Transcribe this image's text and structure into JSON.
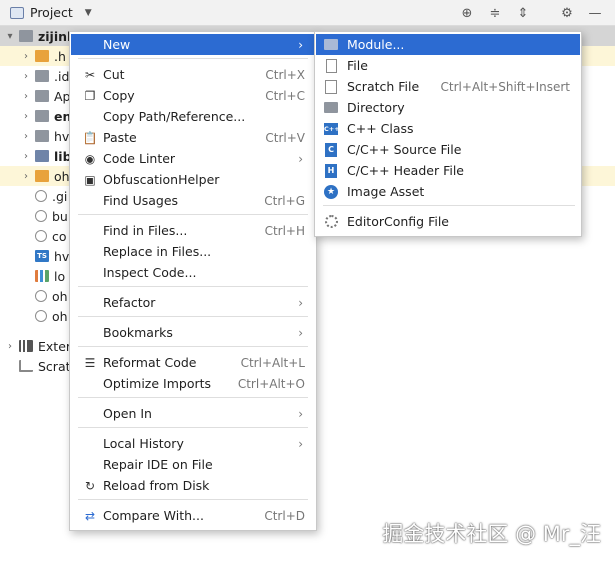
{
  "header": {
    "title": "Project",
    "tools": [
      "target-icon",
      "expand-all-icon",
      "collapse-all-icon",
      "gear-icon",
      "minimize-icon"
    ]
  },
  "tree": {
    "rows": [
      {
        "label": "zijinl",
        "bold": true,
        "arrow": "▾",
        "icon": "folder-gray"
      },
      {
        "label": ".h",
        "arrow": "›",
        "icon": "folder-orange"
      },
      {
        "label": ".id",
        "arrow": "›",
        "icon": "folder-gray"
      },
      {
        "label": "Ap",
        "arrow": "›",
        "icon": "folder-gray"
      },
      {
        "label": "en",
        "bold": true,
        "arrow": "›",
        "icon": "folder-gray"
      },
      {
        "label": "hv",
        "arrow": "›",
        "icon": "folder-gray"
      },
      {
        "label": "lib",
        "bold": true,
        "arrow": "›",
        "icon": "folder-blue"
      },
      {
        "label": "oh",
        "arrow": "›",
        "icon": "folder-orange"
      },
      {
        "label": ".gi",
        "arrow": "",
        "icon": "file-gear"
      },
      {
        "label": "bu",
        "arrow": "",
        "icon": "file-gear"
      },
      {
        "label": "co",
        "arrow": "",
        "icon": "file-gear"
      },
      {
        "label": "hv",
        "arrow": "",
        "icon": "file-ts"
      },
      {
        "label": "lo",
        "arrow": "",
        "icon": "file-bars"
      },
      {
        "label": "oh",
        "arrow": "",
        "icon": "file-gear"
      },
      {
        "label": "oh",
        "arrow": "",
        "icon": "file-gear"
      },
      {
        "label": "Exter",
        "arrow": "›",
        "icon": "file-lib"
      },
      {
        "label": "Scrat",
        "arrow": "",
        "icon": "file-scratch"
      }
    ]
  },
  "menu": {
    "new": {
      "label": "New",
      "submenu": "›"
    },
    "cut": {
      "label": "Cut",
      "shortcut": "Ctrl+X"
    },
    "copy": {
      "label": "Copy",
      "shortcut": "Ctrl+C"
    },
    "copy_path": {
      "label": "Copy Path/Reference..."
    },
    "paste": {
      "label": "Paste",
      "shortcut": "Ctrl+V"
    },
    "code_linter": {
      "label": "Code Linter",
      "submenu": "›"
    },
    "obfuscation": {
      "label": "ObfuscationHelper"
    },
    "find_usages": {
      "label": "Find Usages",
      "shortcut": "Ctrl+G"
    },
    "find_in_files": {
      "label": "Find in Files...",
      "shortcut": "Ctrl+H"
    },
    "replace_in_files": {
      "label": "Replace in Files..."
    },
    "inspect_code": {
      "label": "Inspect Code..."
    },
    "refactor": {
      "label": "Refactor",
      "submenu": "›"
    },
    "bookmarks": {
      "label": "Bookmarks",
      "submenu": "›"
    },
    "reformat": {
      "label": "Reformat Code",
      "shortcut": "Ctrl+Alt+L"
    },
    "optimize": {
      "label": "Optimize Imports",
      "shortcut": "Ctrl+Alt+O"
    },
    "open_in": {
      "label": "Open In",
      "submenu": "›"
    },
    "local_history": {
      "label": "Local History",
      "submenu": "›"
    },
    "repair_ide": {
      "label": "Repair IDE on File"
    },
    "reload": {
      "label": "Reload from Disk"
    },
    "compare": {
      "label": "Compare With...",
      "shortcut": "Ctrl+D"
    }
  },
  "submenu": {
    "module": {
      "label": "Module..."
    },
    "file": {
      "label": "File"
    },
    "scratch": {
      "label": "Scratch File",
      "shortcut": "Ctrl+Alt+Shift+Insert"
    },
    "directory": {
      "label": "Directory"
    },
    "cpp_class": {
      "label": "C++ Class",
      "icon_text": "C++"
    },
    "c_source": {
      "label": "C/C++ Source File",
      "icon_text": "C"
    },
    "c_header": {
      "label": "C/C++ Header File",
      "icon_text": "H"
    },
    "image_asset": {
      "label": "Image Asset"
    },
    "editorconfig": {
      "label": "EditorConfig File"
    }
  },
  "colors": {
    "selection": "#2c6bd2",
    "tree_highlight": "#fdf6d8"
  },
  "watermark": "掘金技术社区 @ Mr_汪"
}
